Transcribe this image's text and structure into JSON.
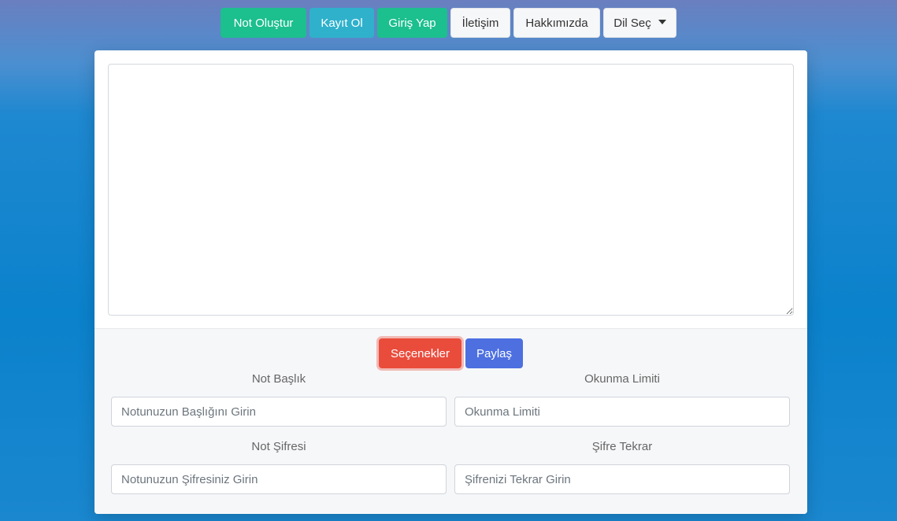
{
  "nav": {
    "create_note": "Not Oluştur",
    "register": "Kayıt Ol",
    "login": "Giriş Yap",
    "contact": "İletişim",
    "about": "Hakkımızda",
    "language": "Dil Seç"
  },
  "editor": {
    "value": ""
  },
  "actions": {
    "options": "Seçenekler",
    "share": "Paylaş"
  },
  "form": {
    "title_label": "Not Başlık",
    "title_placeholder": "Notunuzun Başlığını Girin",
    "limit_label": "Okunma Limiti",
    "limit_placeholder": "Okunma Limiti",
    "password_label": "Not Şifresi",
    "password_placeholder": "Notunuzun Şifresiniz Girin",
    "password_repeat_label": "Şifre Tekrar",
    "password_repeat_placeholder": "Şifrenizi Tekrar Girin"
  },
  "colors": {
    "green": "#1cbf8e",
    "teal": "#2fb1cc",
    "red": "#ea4c3c",
    "blue": "#4d6fe0"
  }
}
